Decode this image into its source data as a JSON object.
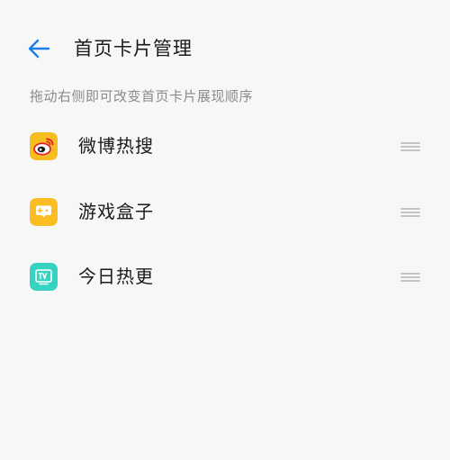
{
  "header": {
    "title": "首页卡片管理",
    "back_icon": "arrow-left-icon",
    "accent_color": "#1e7ee8"
  },
  "hint": "拖动右侧即可改变首页卡片展现顺序",
  "cards": [
    {
      "label": "微博热搜",
      "icon": "weibo-icon",
      "icon_color": "#f5bd1f"
    },
    {
      "label": "游戏盒子",
      "icon": "game-box-icon",
      "icon_color": "#fbbd22"
    },
    {
      "label": "今日热更",
      "icon": "tv-icon",
      "icon_color": "#35d3c0"
    }
  ],
  "drag_icon": "drag-handle-icon"
}
